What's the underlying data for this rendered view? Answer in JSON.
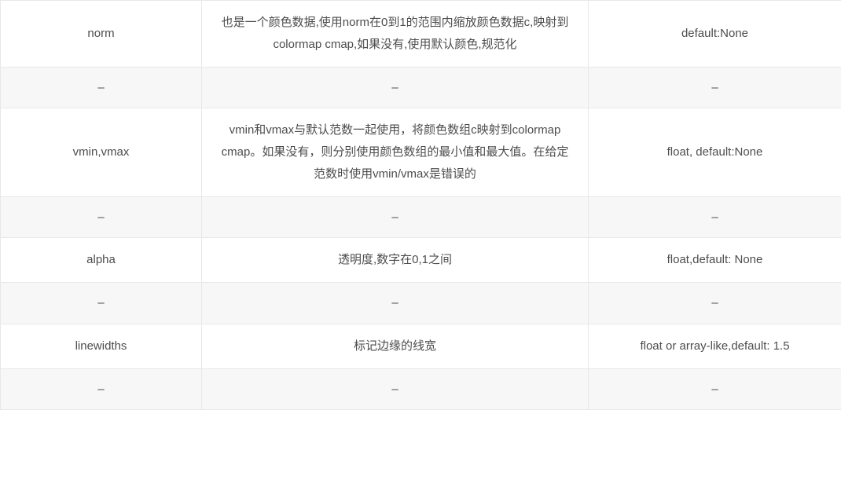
{
  "dash": "–",
  "rows": [
    {
      "type": "data",
      "c1": "norm",
      "c2": "也是一个颜色数据,使用norm在0到1的范围内缩放颜色数据c,映射到colormap cmap,如果没有,使用默认颜色,规范化",
      "c3": "default:None"
    },
    {
      "type": "sep"
    },
    {
      "type": "data",
      "c1": "vmin,vmax",
      "c2": "vmin和vmax与默认范数一起使用，将颜色数组c映射到colormap cmap。如果没有，则分别使用颜色数组的最小值和最大值。在给定范数时使用vmin/vmax是错误的",
      "c3": "float, default:None"
    },
    {
      "type": "sep"
    },
    {
      "type": "data",
      "c1": "alpha",
      "c2": "透明度,数字在0,1之间",
      "c3": "float,default: None"
    },
    {
      "type": "sep"
    },
    {
      "type": "data",
      "c1": "linewidths",
      "c2": "标记边缘的线宽",
      "c3": "float or array-like,default: 1.5"
    },
    {
      "type": "sep"
    }
  ]
}
